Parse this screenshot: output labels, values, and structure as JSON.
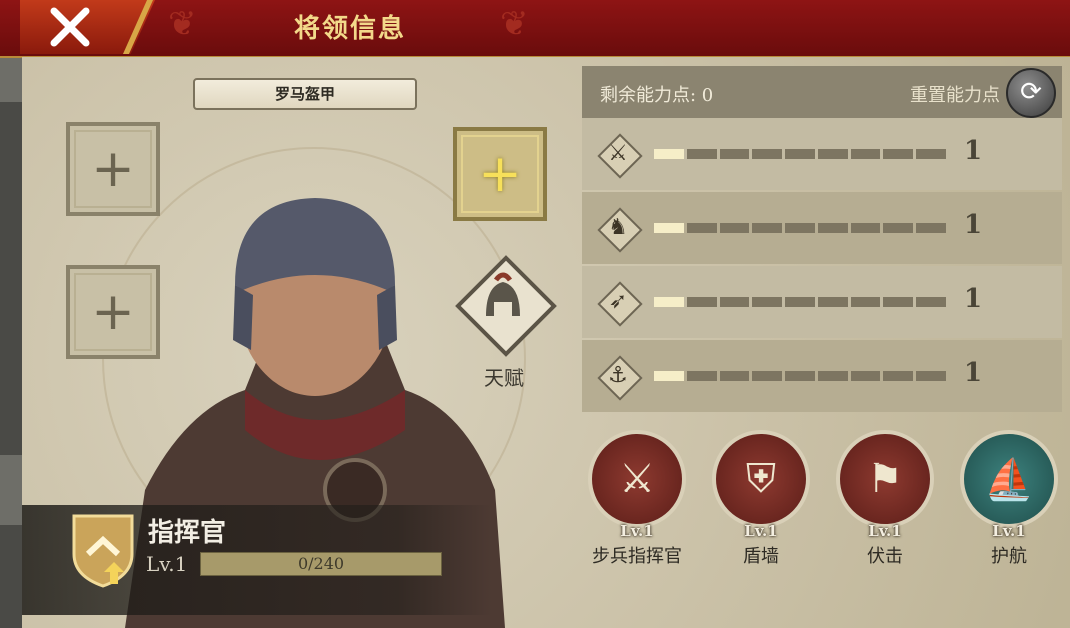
{
  "header": {
    "title": "将领信息",
    "close_icon": "close-x-icon"
  },
  "equipment": {
    "armor_label": "罗马盔甲",
    "slots": [
      {
        "icon": "plus-icon",
        "style": "gray"
      },
      {
        "icon": "plus-icon",
        "style": "gold"
      },
      {
        "icon": "plus-icon",
        "style": "gray"
      }
    ]
  },
  "talent": {
    "label": "天赋",
    "icon": "helmet-icon"
  },
  "commander": {
    "name": "指挥官",
    "level": "Lv.1",
    "xp_text": "0/240",
    "xp_progress": 0
  },
  "stats": {
    "remaining_points_label": "剩余能力点: 0",
    "reset_label": "重置能力点",
    "reset_icon": "refresh-icon",
    "rows": [
      {
        "icon": "sword-icon",
        "value": "1",
        "filled": 1,
        "total": 9
      },
      {
        "icon": "horse-icon",
        "value": "1",
        "filled": 1,
        "total": 9
      },
      {
        "icon": "bow-icon",
        "value": "1",
        "filled": 1,
        "total": 9
      },
      {
        "icon": "anchor-icon",
        "value": "1",
        "filled": 1,
        "total": 9
      }
    ]
  },
  "skills": [
    {
      "name": "步兵指挥官",
      "level": "Lv.1",
      "icon": "crossed-swords-icon",
      "color": "#7a2a22"
    },
    {
      "name": "盾墙",
      "level": "Lv.1",
      "icon": "shield-wall-icon",
      "color": "#7a2a22"
    },
    {
      "name": "伏击",
      "level": "Lv.1",
      "icon": "ambush-icon",
      "color": "#7a2a22"
    },
    {
      "name": "护航",
      "level": "Lv.1",
      "icon": "ship-icon",
      "color": "#2f6a68"
    }
  ]
}
